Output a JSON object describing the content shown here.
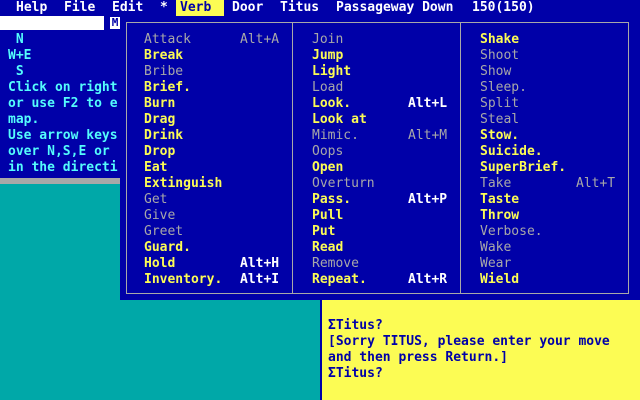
{
  "menubar": {
    "items": [
      {
        "label": "Help",
        "active": false
      },
      {
        "label": "File",
        "active": false
      },
      {
        "label": "Edit",
        "active": false
      },
      {
        "label": "*",
        "active": false
      },
      {
        "label": "Verb",
        "active": true
      },
      {
        "label": "Door",
        "active": false
      },
      {
        "label": "Titus",
        "active": false
      }
    ],
    "location": "Passageway Down",
    "score": "150(150)"
  },
  "compass": {
    "close_label": "M",
    "lines": [
      " N",
      "W+E",
      " S",
      "Click on right",
      "or use F2 to e",
      "map.",
      "Use arrow keys",
      "over N,S,E or",
      "in the directi"
    ]
  },
  "console": {
    "lines": [
      "ΣTitus?",
      "[Sorry TITUS, please enter your move",
      "and then press Return.]",
      "ΣTitus?"
    ]
  },
  "verb_menu": {
    "columns": [
      {
        "items": [
          {
            "label": "Attack",
            "shortcut": "Alt+A",
            "enabled": false
          },
          {
            "label": "Break",
            "shortcut": "",
            "enabled": true
          },
          {
            "label": "Bribe",
            "shortcut": "",
            "enabled": false
          },
          {
            "label": "Brief.",
            "shortcut": "",
            "enabled": true
          },
          {
            "label": "Burn",
            "shortcut": "",
            "enabled": true
          },
          {
            "label": "Drag",
            "shortcut": "",
            "enabled": true
          },
          {
            "label": "Drink",
            "shortcut": "",
            "enabled": true
          },
          {
            "label": "Drop",
            "shortcut": "",
            "enabled": true
          },
          {
            "label": "Eat",
            "shortcut": "",
            "enabled": true
          },
          {
            "label": "Extinguish",
            "shortcut": "",
            "enabled": true
          },
          {
            "label": "Get",
            "shortcut": "",
            "enabled": false
          },
          {
            "label": "Give",
            "shortcut": "",
            "enabled": false
          },
          {
            "label": "Greet",
            "shortcut": "",
            "enabled": false
          },
          {
            "label": "Guard.",
            "shortcut": "",
            "enabled": true
          },
          {
            "label": "Hold",
            "shortcut": "Alt+H",
            "enabled": true
          },
          {
            "label": "Inventory.",
            "shortcut": "Alt+I",
            "enabled": true
          }
        ]
      },
      {
        "items": [
          {
            "label": "Join",
            "shortcut": "",
            "enabled": false
          },
          {
            "label": "Jump",
            "shortcut": "",
            "enabled": true
          },
          {
            "label": "Light",
            "shortcut": "",
            "enabled": true
          },
          {
            "label": "Load",
            "shortcut": "",
            "enabled": false
          },
          {
            "label": "Look.",
            "shortcut": "Alt+L",
            "enabled": true
          },
          {
            "label": "Look at",
            "shortcut": "",
            "enabled": true
          },
          {
            "label": "Mimic.",
            "shortcut": "Alt+M",
            "enabled": false
          },
          {
            "label": "Oops",
            "shortcut": "",
            "enabled": false
          },
          {
            "label": "Open",
            "shortcut": "",
            "enabled": true
          },
          {
            "label": "Overturn",
            "shortcut": "",
            "enabled": false
          },
          {
            "label": "Pass.",
            "shortcut": "Alt+P",
            "enabled": true
          },
          {
            "label": "Pull",
            "shortcut": "",
            "enabled": true
          },
          {
            "label": "Put",
            "shortcut": "",
            "enabled": true
          },
          {
            "label": "Read",
            "shortcut": "",
            "enabled": true
          },
          {
            "label": "Remove",
            "shortcut": "",
            "enabled": false
          },
          {
            "label": "Repeat.",
            "shortcut": "Alt+R",
            "enabled": true
          }
        ]
      },
      {
        "items": [
          {
            "label": "Shake",
            "shortcut": "",
            "enabled": true
          },
          {
            "label": "Shoot",
            "shortcut": "",
            "enabled": false
          },
          {
            "label": "Show",
            "shortcut": "",
            "enabled": false
          },
          {
            "label": "Sleep.",
            "shortcut": "",
            "enabled": false
          },
          {
            "label": "Split",
            "shortcut": "",
            "enabled": false
          },
          {
            "label": "Steal",
            "shortcut": "",
            "enabled": false
          },
          {
            "label": "Stow.",
            "shortcut": "",
            "enabled": true
          },
          {
            "label": "Suicide.",
            "shortcut": "",
            "enabled": true
          },
          {
            "label": "SuperBrief.",
            "shortcut": "",
            "enabled": true
          },
          {
            "label": "Take",
            "shortcut": "Alt+T",
            "enabled": false
          },
          {
            "label": "Taste",
            "shortcut": "",
            "enabled": true
          },
          {
            "label": "Throw",
            "shortcut": "",
            "enabled": true
          },
          {
            "label": "Verbose.",
            "shortcut": "",
            "enabled": false
          },
          {
            "label": "Wake",
            "shortcut": "",
            "enabled": false
          },
          {
            "label": "Wear",
            "shortcut": "",
            "enabled": false
          },
          {
            "label": "Wield",
            "shortcut": "",
            "enabled": true
          }
        ]
      }
    ]
  },
  "colors": {
    "menu_bg": "#0000a8",
    "menu_enabled": "#fcfc54",
    "menu_disabled": "#a8a8a8",
    "desktop": "#00a8a8",
    "console_bg": "#fcfc54"
  }
}
